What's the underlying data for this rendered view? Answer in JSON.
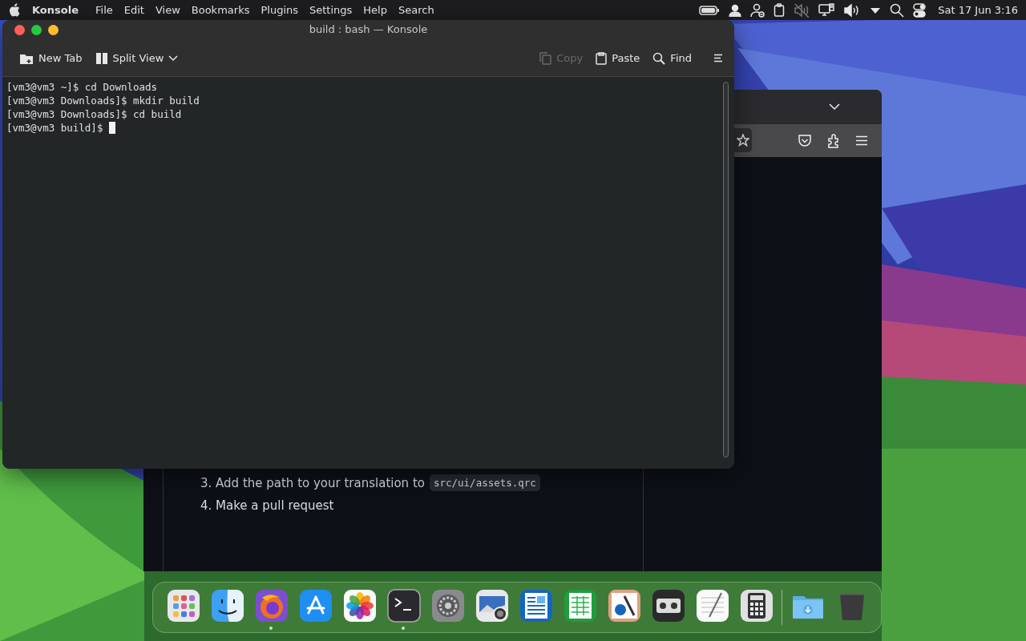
{
  "menubar": {
    "app_name": "Konsole",
    "menus": [
      "File",
      "Edit",
      "View",
      "Bookmarks",
      "Plugins",
      "Settings",
      "Help",
      "Search"
    ],
    "clock": "Sat 17 Jun 3:16"
  },
  "konsole": {
    "title": "build : bash — Konsole",
    "toolbar": [
      {
        "kind": "newtab",
        "label": "New Tab",
        "disabled": false
      },
      {
        "kind": "split",
        "label": "Split View",
        "disabled": false
      },
      {
        "kind": "copy",
        "label": "Copy",
        "disabled": true
      },
      {
        "kind": "paste",
        "label": "Paste",
        "disabled": false
      },
      {
        "kind": "find",
        "label": "Find",
        "disabled": false
      }
    ],
    "terminal_lines": [
      "[vm3@vm3 ~]$ cd Downloads",
      "[vm3@vm3 Downloads]$ mkdir build",
      "[vm3@vm3 Downloads]$ cd build",
      "[vm3@vm3 build]$ "
    ],
    "cursor": true
  },
  "browser": {
    "list_items": [
      {
        "text": "3. Add the path to your translation to",
        "code": "src/ui/assets.qrc"
      },
      {
        "text": "4. Make a pull request"
      }
    ]
  },
  "dock": {
    "items": [
      {
        "running": false
      },
      {
        "running": false
      },
      {
        "running": true
      },
      {
        "running": false
      },
      {
        "running": false
      },
      {
        "running": true
      },
      {
        "running": false
      },
      {
        "running": false
      },
      {
        "running": false
      },
      {
        "running": false
      },
      {
        "running": false
      },
      {
        "running": false
      },
      {
        "running": false
      },
      {
        "running": false
      },
      {
        "running": false
      },
      {
        "running": false
      }
    ]
  }
}
